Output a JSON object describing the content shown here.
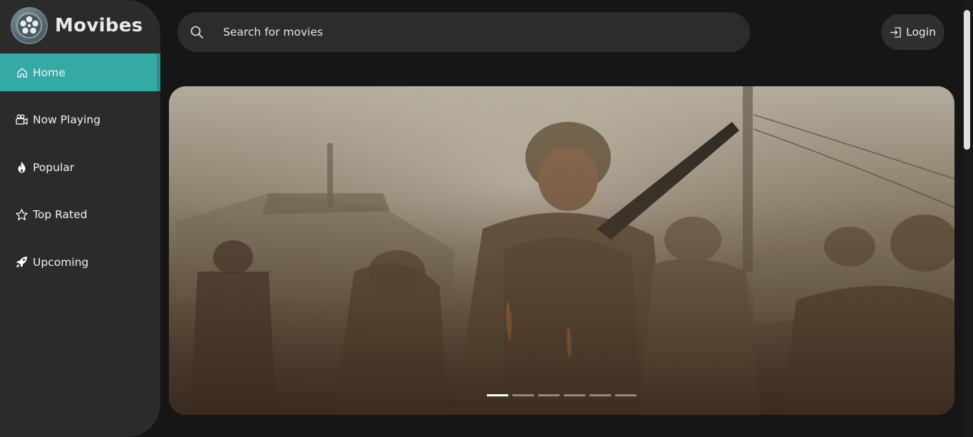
{
  "app": {
    "name": "Movibes"
  },
  "colors": {
    "accent": "#35aaa5",
    "sidebar": "#2b2b2b",
    "background": "#161616"
  },
  "sidebar": {
    "items": [
      {
        "label": "Home",
        "icon": "home-icon",
        "active": true
      },
      {
        "label": "Now Playing",
        "icon": "camera-icon",
        "active": false
      },
      {
        "label": "Popular",
        "icon": "fire-icon",
        "active": false
      },
      {
        "label": "Top Rated",
        "icon": "star-icon",
        "active": false
      },
      {
        "label": "Upcoming",
        "icon": "rocket-icon",
        "active": false
      }
    ]
  },
  "search": {
    "placeholder": "Search for movies"
  },
  "header": {
    "login_label": "Login"
  },
  "carousel": {
    "slide_count": 6,
    "active_index": 0
  }
}
